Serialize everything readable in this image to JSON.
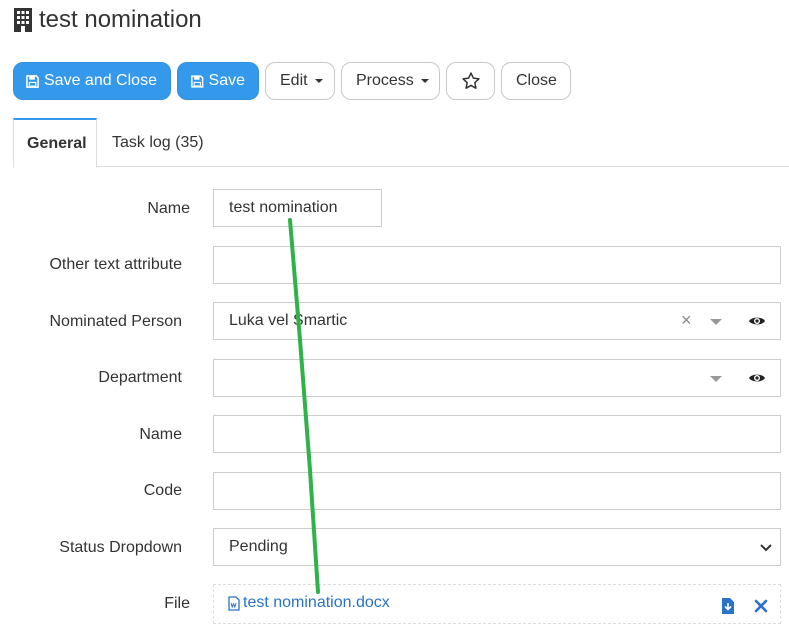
{
  "page": {
    "title": "test nomination"
  },
  "toolbar": {
    "save_close_label": "Save and Close",
    "save_label": "Save",
    "edit_label": "Edit",
    "process_label": "Process",
    "close_label": "Close"
  },
  "tabs": [
    {
      "label": "General",
      "active": true
    },
    {
      "label": "Task log (35)",
      "active": false
    }
  ],
  "form": {
    "name": {
      "label": "Name",
      "value": "test nomination"
    },
    "other_text": {
      "label": "Other text attribute",
      "value": ""
    },
    "nominated_person": {
      "label": "Nominated Person",
      "value": "Luka vel Smartic"
    },
    "department": {
      "label": "Department",
      "value": ""
    },
    "name2": {
      "label": "Name",
      "value": ""
    },
    "code": {
      "label": "Code",
      "value": ""
    },
    "status": {
      "label": "Status Dropdown",
      "value": "Pending"
    },
    "file": {
      "label": "File",
      "filename": "test nomination.docx"
    }
  },
  "icons": {
    "title": "building-icon",
    "save_close": "floppy-disk-icon",
    "save": "floppy-disk-icon",
    "favorite": "star-icon",
    "view": "eye-icon",
    "clear": "close-icon",
    "select": "chevron-down-icon",
    "file_type": "word-document-icon",
    "download": "download-icon",
    "remove": "close-icon"
  },
  "colors": {
    "primary": "#3499ea",
    "link": "#2a72c7",
    "annotation_line": "#2fb24a"
  }
}
